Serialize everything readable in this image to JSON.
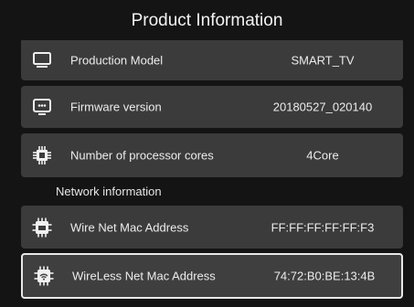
{
  "header": {
    "title": "Product Information"
  },
  "rows_top": [
    {
      "label": "Production Model",
      "value": "SMART_TV",
      "icon": "monitor-icon"
    },
    {
      "label": "Firmware version",
      "value": "20180527_020140",
      "icon": "firmware-screen-icon"
    },
    {
      "label": "Number of processor cores",
      "value": "4Core",
      "icon": "processor-chip-icon"
    }
  ],
  "network": {
    "section_title": "Network information",
    "rows": [
      {
        "label": "Wire Net Mac Address",
        "value": "FF:FF:FF:FF:FF:F3",
        "icon": "ethernet-chip-icon"
      },
      {
        "label": "WireLess Net Mac Address",
        "value": "74:72:B0:BE:13:4B",
        "icon": "wifi-chip-icon"
      }
    ]
  },
  "colors": {
    "background": "#141414",
    "row": "#3b3b3b",
    "selected_border": "#e8e8e8"
  }
}
